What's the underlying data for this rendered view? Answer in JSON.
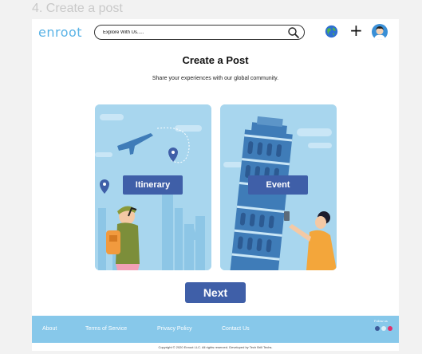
{
  "frame_caption": "4. Create a post",
  "header": {
    "logo": "enroot",
    "search_placeholder": "Explore With Us.....",
    "icons": [
      "search-icon",
      "globe-icon",
      "plus-icon",
      "avatar-icon"
    ],
    "plus_glyph": "+"
  },
  "main": {
    "title": "Create a Post",
    "subtitle": "Share your experiences with our global community.",
    "cards": [
      {
        "label": "Itinerary"
      },
      {
        "label": "Event"
      }
    ],
    "next_label": "Next"
  },
  "footer": {
    "links": [
      "About",
      "Terms of Service",
      "Privacy Policy",
      "Contact Us"
    ],
    "follow_label": "Follow us",
    "social_colors": [
      "#3b5998",
      "#87c8ea",
      "#e1306c"
    ],
    "copyright": "Copyright © 2020 Enroot LLC. All rights reserved. Developed by Tech Brill Techs."
  },
  "colors": {
    "accent": "#3f5fa8",
    "brand": "#5ab3e6",
    "footer_bg": "#87c8ea",
    "card_bg": "#a8d6ee"
  }
}
